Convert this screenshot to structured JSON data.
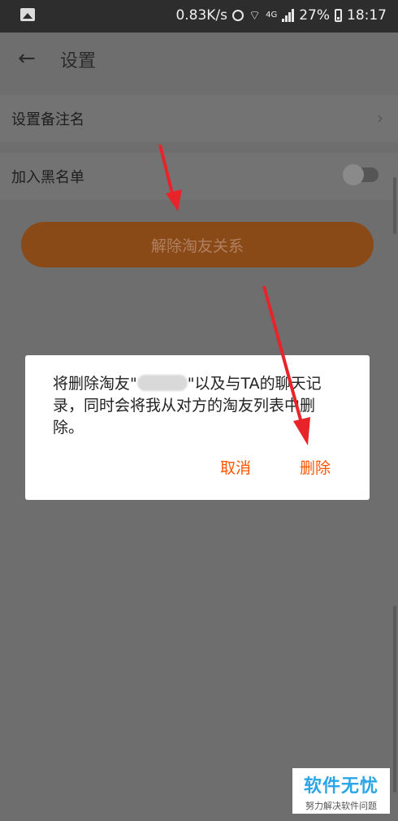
{
  "status_bar": {
    "speed": "0.83K/s",
    "network_type": "4G",
    "battery": "27%",
    "time": "18:17",
    "icons": [
      "gallery-icon",
      "alarm-icon",
      "wifi-icon",
      "signal-icon",
      "battery-icon"
    ]
  },
  "header": {
    "back_icon": "←",
    "title": "设置"
  },
  "settings": {
    "remark_label": "设置备注名",
    "blacklist_label": "加入黑名单",
    "blacklist_enabled": false,
    "unbind_button": "解除淘友关系"
  },
  "dialog": {
    "message_prefix": "将删除淘友\"",
    "message_suffix": "\"以及与TA的聊天记录，同时会将我从对方的淘友列表中删除。",
    "cancel": "取消",
    "delete": "删除"
  },
  "watermark": {
    "title": "软件无忧",
    "subtitle": "努力解决软件问题"
  },
  "colors": {
    "accent": "#ff5500",
    "annotation_arrow": "#e8232a",
    "watermark_blue": "#2aa6e8"
  }
}
